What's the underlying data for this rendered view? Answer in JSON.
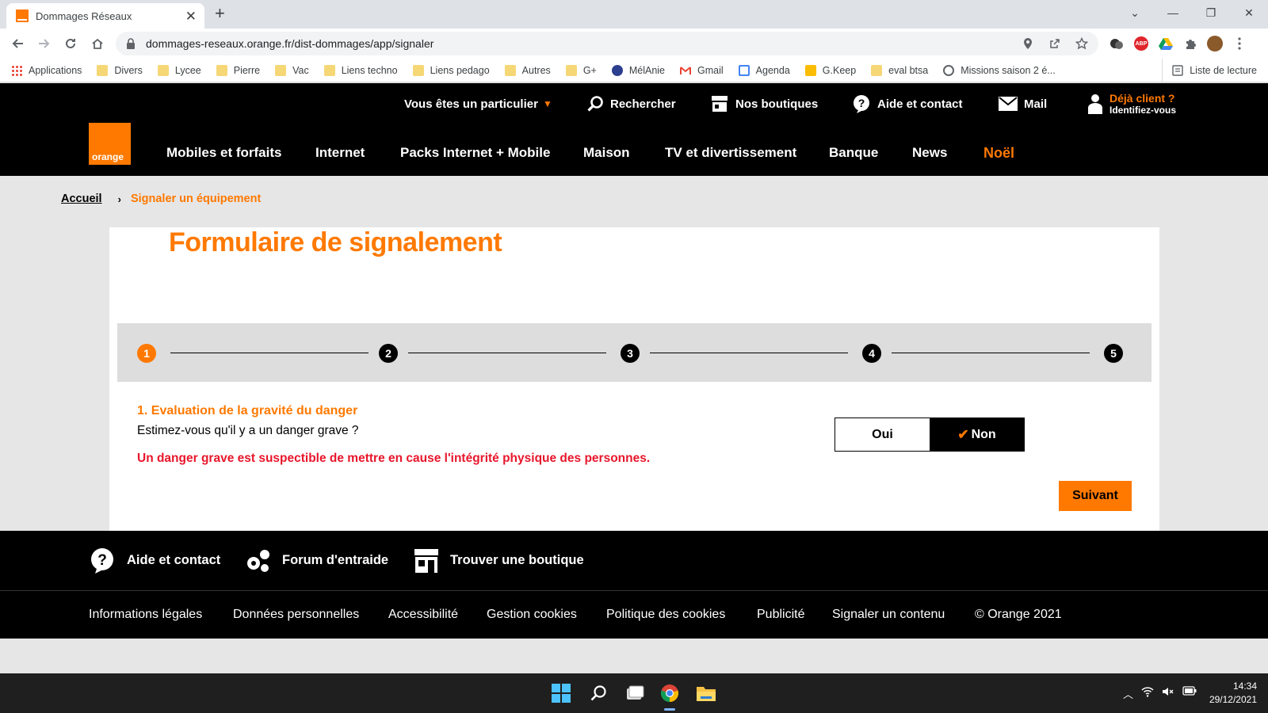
{
  "browser": {
    "tab_title": "Dommages Réseaux",
    "url": "dommages-reseaux.orange.fr/dist-dommages/app/signaler",
    "bookmarks": [
      {
        "label": "Applications",
        "icon": "apps-grid-icon"
      },
      {
        "label": "Divers",
        "icon": "folder-icon"
      },
      {
        "label": "Lycee",
        "icon": "folder-icon"
      },
      {
        "label": "Pierre",
        "icon": "folder-icon"
      },
      {
        "label": "Vac",
        "icon": "folder-icon"
      },
      {
        "label": "Liens techno",
        "icon": "folder-icon"
      },
      {
        "label": "Liens pedago",
        "icon": "folder-icon"
      },
      {
        "label": "Autres",
        "icon": "folder-icon"
      },
      {
        "label": "G+",
        "icon": "folder-icon"
      },
      {
        "label": "MélAnie",
        "icon": "melanie-icon"
      },
      {
        "label": "Gmail",
        "icon": "gmail-icon"
      },
      {
        "label": "Agenda",
        "icon": "calendar-icon"
      },
      {
        "label": "G.Keep",
        "icon": "keep-icon"
      },
      {
        "label": "eval btsa",
        "icon": "folder-icon"
      },
      {
        "label": "Missions saison 2 é...",
        "icon": "globe-icon"
      }
    ],
    "reading_list": "Liste de lecture"
  },
  "header": {
    "particulier": "Vous êtes un particulier",
    "search": "Rechercher",
    "shops": "Nos boutiques",
    "help": "Aide et contact",
    "mail": "Mail",
    "client_title": "Déjà client ?",
    "client_sub": "Identifiez-vous",
    "logo_text": "orange",
    "nav": [
      "Mobiles et forfaits",
      "Internet",
      "Packs Internet + Mobile",
      "Maison",
      "TV et divertissement",
      "Banque",
      "News",
      "Noël"
    ]
  },
  "breadcrumb": {
    "home": "Accueil",
    "current": "Signaler un équipement"
  },
  "form": {
    "title": "Formulaire de signalement",
    "steps": [
      "1",
      "2",
      "3",
      "4",
      "5"
    ],
    "active_step": 1,
    "question_title": "1. Evaluation de la gravité du danger",
    "question": "Estimez-vous qu'il y a un danger grave ?",
    "warning": "Un danger grave est suspectible de mettre en cause l'intégrité physique des personnes.",
    "option_yes": "Oui",
    "option_no": "Non",
    "selected": "Non",
    "next": "Suivant"
  },
  "footer": {
    "top": [
      "Aide et contact",
      "Forum d'entraide",
      "Trouver une boutique"
    ],
    "bottom": [
      "Informations légales",
      "Données personnelles",
      "Accessibilité",
      "Gestion cookies",
      "Politique des cookies",
      "Publicité",
      "Signaler un contenu",
      "© Orange 2021"
    ]
  },
  "taskbar": {
    "time": "14:34",
    "date": "29/12/2021"
  },
  "colors": {
    "brand": "#ff7900",
    "warning": "#e8162b",
    "black": "#000000"
  }
}
